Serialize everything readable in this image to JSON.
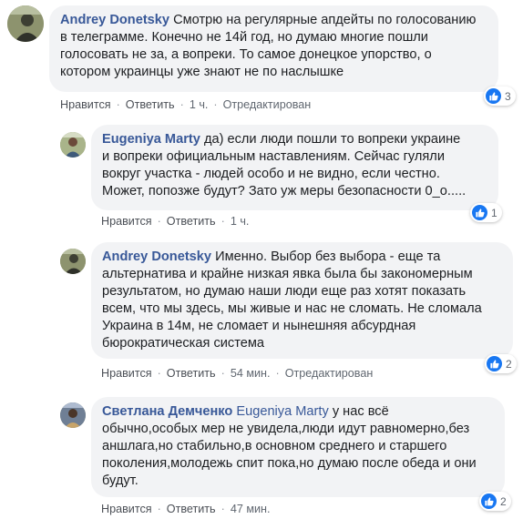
{
  "comments": [
    {
      "author": "Andrey Donetsky",
      "lines": [
        "Смотрю на регулярные апдейты по голосованию",
        "в телеграмме. Конечно не 14й год, но думаю многие пошли",
        "голосовать не за, а вопреки. То самое донецкое упорство, о",
        "котором украинцы уже знают не по наслышке"
      ],
      "like": "Нравится",
      "reply": "Ответить",
      "time": "1 ч.",
      "edited": "Отредактирован",
      "reactions": "3"
    },
    {
      "author": "Eugeniya Marty",
      "lines": [
        "да) если люди пошли то вопреки украине",
        "и вопреки официальным наставлениям. Сейчас гуляли",
        "вокруг участка - людей особо и не видно, если честно.",
        "Может, попозже будут? Зато уж меры безопасности 0_о....."
      ],
      "like": "Нравится",
      "reply": "Ответить",
      "time": "1 ч.",
      "reactions": "1"
    },
    {
      "author": "Andrey Donetsky",
      "lines": [
        "Именно. Выбор без выбора - еще та",
        "альтернатива и крайне низкая явка была бы закономерным",
        "результатом, но думаю наши люди еще раз хотят показать",
        "всем, что мы здесь, мы живые и нас не сломать. Не сломала",
        "Украина в 14м, не сломает и нынешняя абсурдная",
        "бюрократическая система"
      ],
      "like": "Нравится",
      "reply": "Ответить",
      "time": "54 мин.",
      "edited": "Отредактирован",
      "reactions": "2"
    },
    {
      "author": "Светлана Демченко",
      "mention": "Eugeniya Marty",
      "lines": [
        "у нас всё",
        "обычно,особых мер не увидела,люди идут равномерно,без",
        "аншлага,но стабильно,в основном среднего и старшего",
        "поколения,молодежь спит пока,но думаю после обеда и они",
        "будут."
      ],
      "like": "Нравится",
      "reply": "Ответить",
      "time": "47 мин.",
      "reactions": "2"
    }
  ]
}
